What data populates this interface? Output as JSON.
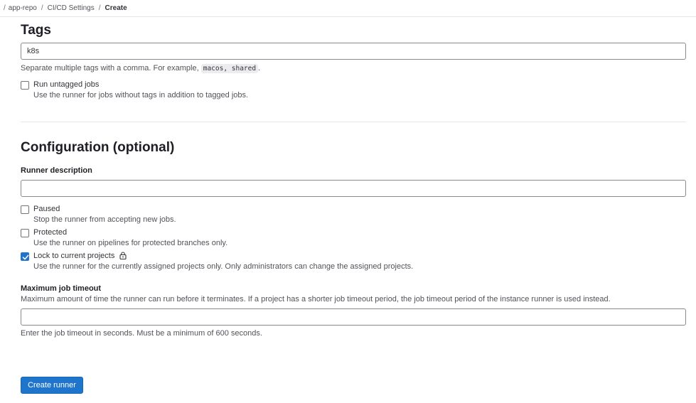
{
  "breadcrumb": {
    "separator": "/",
    "items": [
      "app-repo",
      "CI/CD Settings",
      "Create"
    ]
  },
  "tags": {
    "heading": "Tags",
    "value": "k8s",
    "help_prefix": "Separate multiple tags with a comma. For example,",
    "help_code": "macos, shared",
    "help_suffix": ".",
    "run_untagged": {
      "label": "Run untagged jobs",
      "help": "Use the runner for jobs without tags in addition to tagged jobs.",
      "checked": false
    }
  },
  "configuration": {
    "heading": "Configuration (optional)",
    "description_label": "Runner description",
    "description_value": "",
    "paused": {
      "label": "Paused",
      "help": "Stop the runner from accepting new jobs.",
      "checked": false
    },
    "protected": {
      "label": "Protected",
      "help": "Use the runner on pipelines for protected branches only.",
      "checked": false
    },
    "lock": {
      "label": "Lock to current projects",
      "help": "Use the runner for the currently assigned projects only. Only administrators can change the assigned projects.",
      "checked": true,
      "icon": "lock-icon"
    },
    "timeout": {
      "label": "Maximum job timeout",
      "description": "Maximum amount of time the runner can run before it terminates. If a project has a shorter job timeout period, the job timeout period of the instance runner is used instead.",
      "value": "",
      "help": "Enter the job timeout in seconds. Must be a minimum of 600 seconds."
    }
  },
  "actions": {
    "create_label": "Create runner"
  },
  "colors": {
    "primary": "#1f75cb",
    "text": "#333238",
    "muted": "#535158",
    "border": "#89888d"
  }
}
